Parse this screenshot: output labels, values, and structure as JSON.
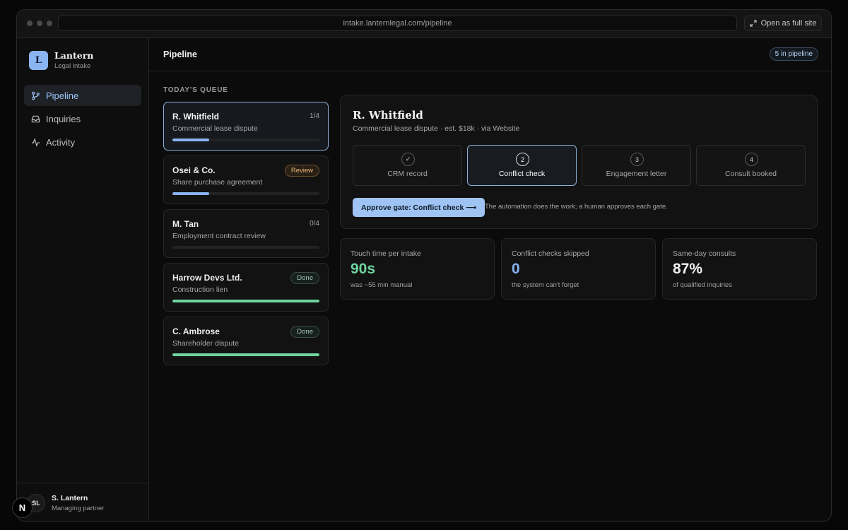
{
  "browser": {
    "url": "intake.lanternlegal.com/pipeline",
    "open_full_site": "Open as full site"
  },
  "brand": {
    "logo_letter": "L",
    "name": "Lantern",
    "subtitle": "Legal intake"
  },
  "nav": [
    {
      "label": "Pipeline",
      "icon": "branch-icon",
      "active": true
    },
    {
      "label": "Inquiries",
      "icon": "inbox-icon",
      "active": false
    },
    {
      "label": "Activity",
      "icon": "activity-icon",
      "active": false
    }
  ],
  "user": {
    "initials": "SL",
    "name": "S. Lantern",
    "role": "Managing partner"
  },
  "header": {
    "title": "Pipeline",
    "badge": "5 in pipeline"
  },
  "queue": {
    "label": "TODAY'S QUEUE",
    "items": [
      {
        "name": "R. Whitfield",
        "desc": "Commercial lease dispute",
        "status": "1/4",
        "progress": 0.25
      },
      {
        "name": "Osei & Co.",
        "desc": "Share purchase agreement",
        "status": "Review",
        "progress": 0.25
      },
      {
        "name": "M. Tan",
        "desc": "Employment contract review",
        "status": "0/4",
        "progress": 0
      },
      {
        "name": "Harrow Devs Ltd.",
        "desc": "Construction lien",
        "status": "Done",
        "progress": 1
      },
      {
        "name": "C. Ambrose",
        "desc": "Shareholder dispute",
        "status": "Done",
        "progress": 1
      }
    ]
  },
  "detail": {
    "name": "R. Whitfield",
    "meta": "Commercial lease dispute · est. $18k · via Website",
    "steps": [
      {
        "num": "✓",
        "label": "CRM record"
      },
      {
        "num": "2",
        "label": "Conflict check"
      },
      {
        "num": "3",
        "label": "Engagement letter"
      },
      {
        "num": "4",
        "label": "Consult booked"
      }
    ],
    "approve_label": "Approve gate: Conflict check ⟶",
    "note": "The automation does the work; a human approves each gate."
  },
  "metrics": [
    {
      "label": "Touch time per intake",
      "value": "90s",
      "sub": "was ~55 min manual",
      "color": "#6fd4a0"
    },
    {
      "label": "Conflict checks skipped",
      "value": "0",
      "sub": "the system can't forget",
      "color": "#8ab4f0"
    },
    {
      "label": "Same-day consults",
      "value": "87%",
      "sub": "of qualified inquiries",
      "color": "#f2f2f2"
    }
  ],
  "colors": {
    "accent": "#8ab4f0",
    "success": "#6fd4a0",
    "warning": "#e8b77d"
  },
  "floating_button": "N"
}
